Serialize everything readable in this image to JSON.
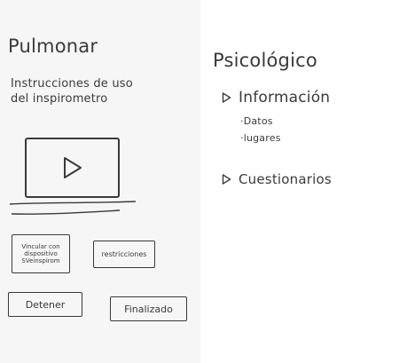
{
  "left_panel": {
    "title": "Pulmonar",
    "instructions": "Instrucciones de uso del inspirometro",
    "video": {
      "icon": "play-icon"
    },
    "buttons": {
      "vincular": "Vincular con dispositivo SVeinspirom",
      "restricciones": "restricciones",
      "detener": "Detener",
      "finalizado": "Finalizado"
    }
  },
  "right_panel": {
    "title": "Psicológico",
    "menu": [
      {
        "label": "Información",
        "icon": "triangle-right-icon",
        "subitems": [
          "·Datos",
          "·lugares"
        ]
      },
      {
        "label": "Cuestionarios",
        "icon": "triangle-right-icon"
      }
    ]
  }
}
